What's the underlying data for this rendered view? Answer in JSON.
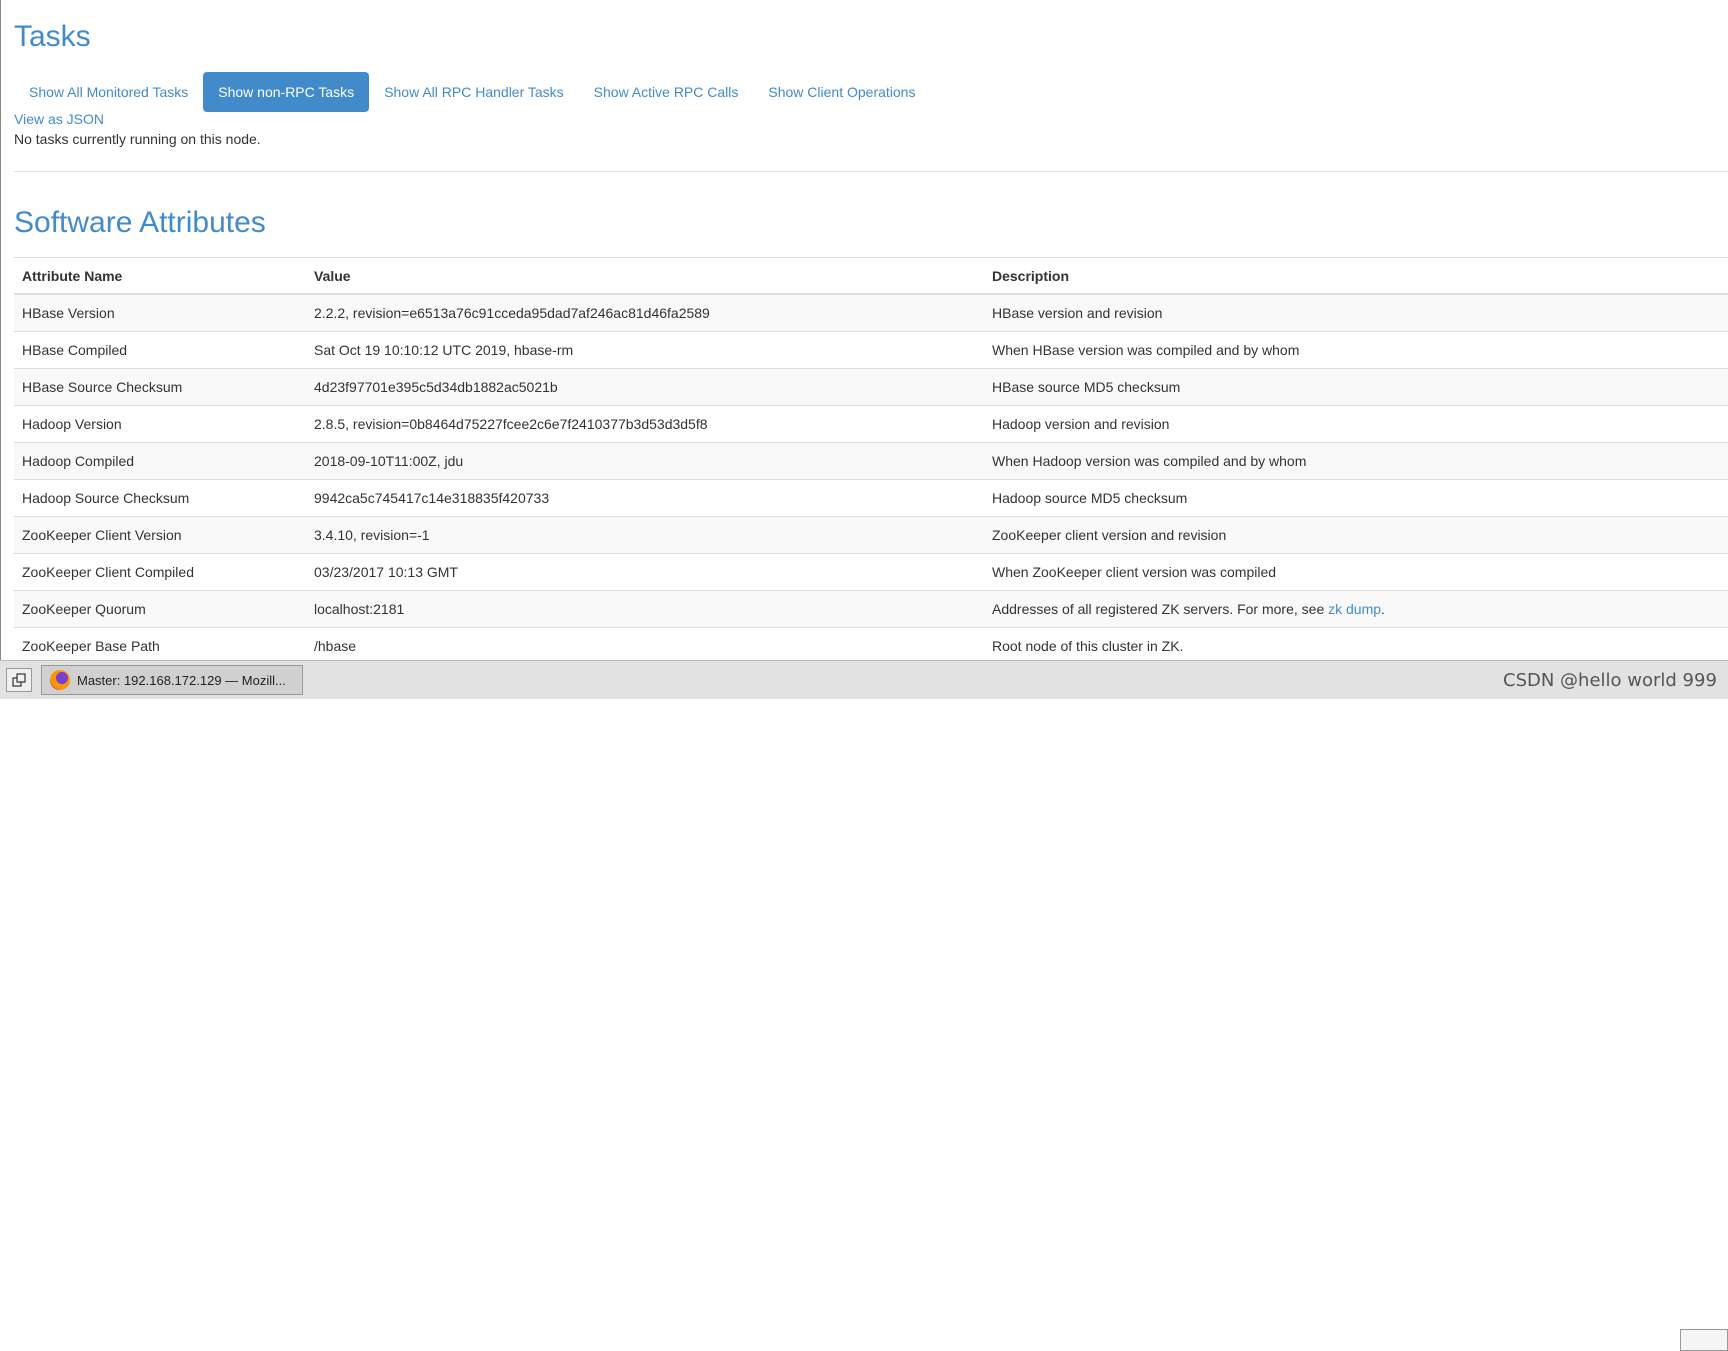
{
  "tasks": {
    "title": "Tasks",
    "tabs": [
      {
        "label": "Show All Monitored Tasks",
        "active": false
      },
      {
        "label": "Show non-RPC Tasks",
        "active": true
      },
      {
        "label": "Show All RPC Handler Tasks",
        "active": false
      },
      {
        "label": "Show Active RPC Calls",
        "active": false
      },
      {
        "label": "Show Client Operations",
        "active": false
      }
    ],
    "json_link": "View as JSON",
    "no_tasks_message": "No tasks currently running on this node."
  },
  "software": {
    "title": "Software Attributes",
    "headers": [
      "Attribute Name",
      "Value",
      "Description"
    ],
    "rows": [
      {
        "name": "HBase Version",
        "value": "2.2.2, revision=e6513a76c91cceda95dad7af246ac81d46fa2589",
        "description": "HBase version and revision"
      },
      {
        "name": "HBase Compiled",
        "value": "Sat Oct 19 10:10:12 UTC 2019, hbase-rm",
        "description": "When HBase version was compiled and by whom"
      },
      {
        "name": "HBase Source Checksum",
        "value": "4d23f97701e395c5d34db1882ac5021b",
        "description": "HBase source MD5 checksum"
      },
      {
        "name": "Hadoop Version",
        "value": "2.8.5, revision=0b8464d75227fcee2c6e7f2410377b3d53d3d5f8",
        "description": "Hadoop version and revision"
      },
      {
        "name": "Hadoop Compiled",
        "value": "2018-09-10T11:00Z, jdu",
        "description": "When Hadoop version was compiled and by whom"
      },
      {
        "name": "Hadoop Source Checksum",
        "value": "9942ca5c745417c14e318835f420733",
        "description": "Hadoop source MD5 checksum"
      },
      {
        "name": "ZooKeeper Client Version",
        "value": "3.4.10, revision=-1",
        "description": "ZooKeeper client version and revision"
      },
      {
        "name": "ZooKeeper Client Compiled",
        "value": "03/23/2017 10:13 GMT",
        "description": "When ZooKeeper client version was compiled"
      },
      {
        "name": "ZooKeeper Quorum",
        "value": "localhost:2181",
        "description": "Addresses of all registered ZK servers. For more, see ",
        "link": "zk dump",
        "suffix": "."
      },
      {
        "name": "ZooKeeper Base Path",
        "value": "/hbase",
        "description": "Root node of this cluster in ZK."
      }
    ]
  },
  "taskbar": {
    "window_title": "Master: 192.168.172.129 — Mozill...",
    "app_icon": "firefox-icon",
    "show_desktop_icon": "show-desktop-icon"
  },
  "watermark": "CSDN @hello world 999"
}
